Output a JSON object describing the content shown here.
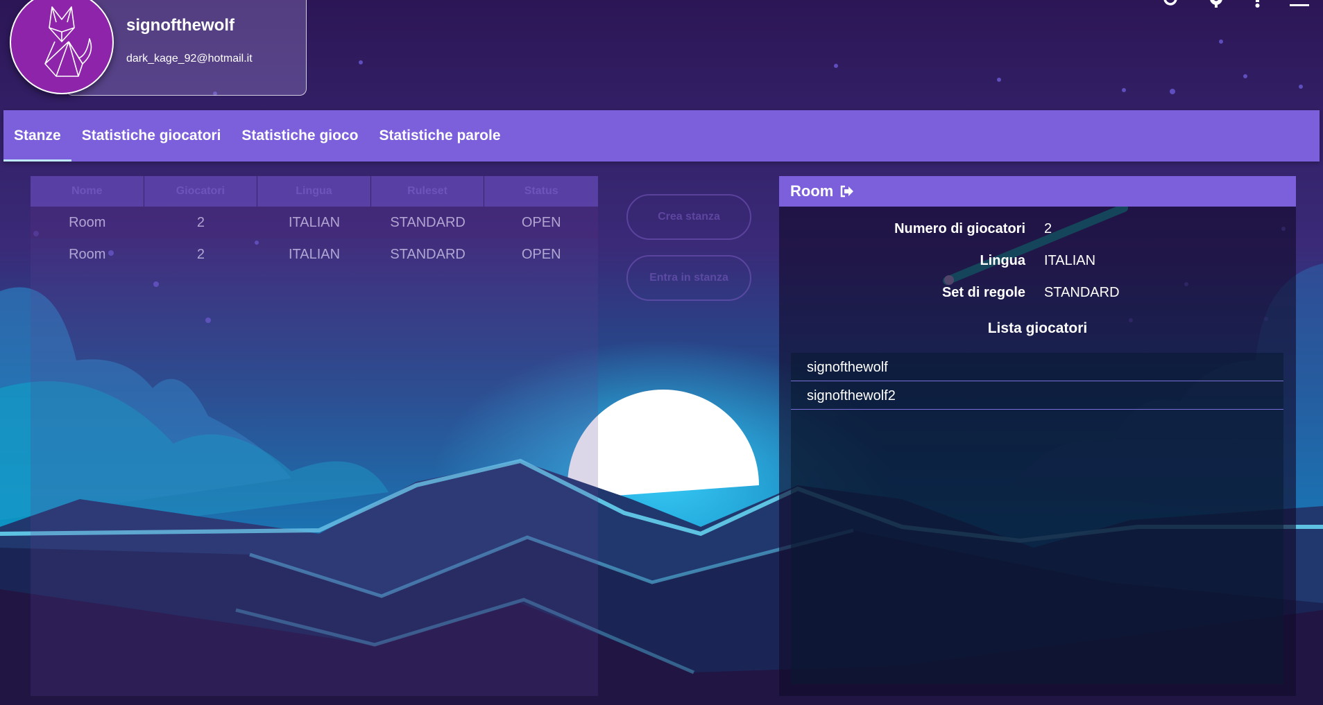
{
  "user": {
    "username": "signofthewolf",
    "email": "dark_kage_92@hotmail.it",
    "avatar_icon": "fox-icon",
    "avatar_color": "#8e24aa"
  },
  "top_icons": [
    "refresh-icon",
    "gear-icon",
    "help-icon",
    "menu-icon"
  ],
  "tabs": [
    {
      "label": "Stanze",
      "active": true
    },
    {
      "label": "Statistiche giocatori",
      "active": false
    },
    {
      "label": "Statistiche gioco",
      "active": false
    },
    {
      "label": "Statistiche parole",
      "active": false
    }
  ],
  "rooms_table": {
    "columns": [
      "Nome",
      "Giocatori",
      "Lingua",
      "Ruleset",
      "Status"
    ],
    "rows": [
      {
        "nome": "Room",
        "giocatori": "2",
        "lingua": "ITALIAN",
        "ruleset": "STANDARD",
        "status": "OPEN"
      },
      {
        "nome": "Room",
        "giocatori": "2",
        "lingua": "ITALIAN",
        "ruleset": "STANDARD",
        "status": "OPEN"
      }
    ]
  },
  "actions": {
    "create": "Crea stanza",
    "join": "Entra in stanza"
  },
  "room": {
    "title": "Room",
    "exit_icon": "sign-out-icon",
    "fields": [
      {
        "label": "Numero di giocatori",
        "value": "2"
      },
      {
        "label": "Lingua",
        "value": "ITALIAN"
      },
      {
        "label": "Set di regole",
        "value": "STANDARD"
      }
    ],
    "players_title": "Lista giocatori",
    "players": [
      "signofthewolf",
      "signofthewolf2"
    ]
  },
  "colors": {
    "accent": "#7b5fdb",
    "background": "#2a1756",
    "tab_underline": "#bfe9ff"
  }
}
